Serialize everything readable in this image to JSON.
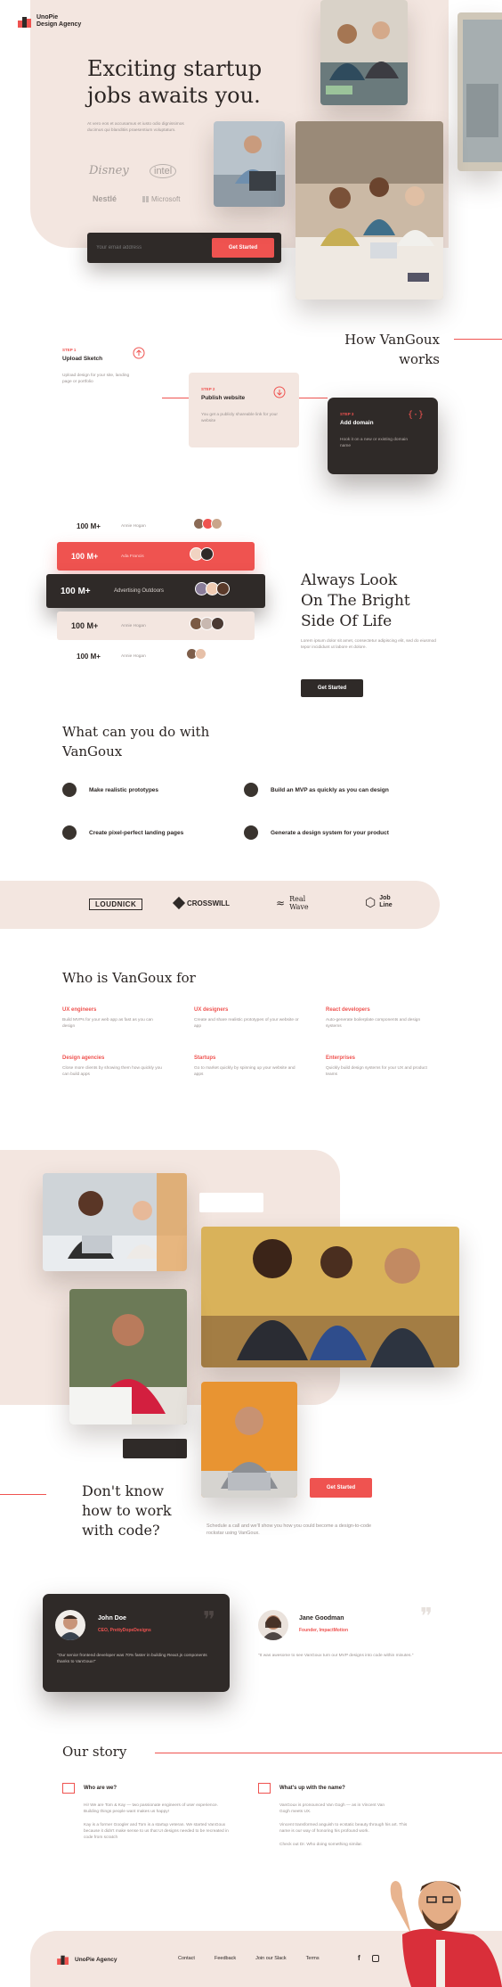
{
  "brand": {
    "name_line1": "UnoPie",
    "name_line2": "Design Agency",
    "footer_name": "UnoPie Agency"
  },
  "hero": {
    "title_line1": "Exciting startup",
    "title_line2": "jobs awaits you.",
    "description": "At vero eos et accusamus et iusto odio dignissimos ducimus qui blanditiis praesentium voluptatum.",
    "client_logos": [
      "Disney",
      "intel",
      "Nestlé",
      "Microsoft"
    ],
    "email_placeholder": "Your email address",
    "cta_label": "Get Started"
  },
  "how": {
    "title_line1": "How VanGoux",
    "title_line2": "works",
    "steps": [
      {
        "step": "STEP 1",
        "title": "Upload Sketch",
        "text": "Upload design for your site, landing page or portfolio"
      },
      {
        "step": "STEP 2",
        "title": "Publish website",
        "text": "You get a publicly shareable link for your website"
      },
      {
        "step": "STEP 3",
        "title": "Add domain",
        "text": "Hook it on a new or existing domain name"
      }
    ]
  },
  "stats": {
    "rows": [
      {
        "value": "100 M+",
        "name": "Annie Hogan"
      },
      {
        "value": "100 M+",
        "name": "Ada Francis"
      },
      {
        "value": "100 M+",
        "name": "Advertising Outdoors"
      },
      {
        "value": "100 M+",
        "name": "Annie Hogan"
      },
      {
        "value": "100 M+",
        "name": "Annie Hogan"
      }
    ]
  },
  "bright": {
    "title_line1": "Always Look",
    "title_line2": "On The Bright",
    "title_line3": "Side Of Life",
    "text": "Lorem ipsum dolor sit amet, consectetur adipiscing elit, sed do eiusmod tepor incididunt ut labore et dolore.",
    "button": "Get Started"
  },
  "what": {
    "title_line1": "What can you do with",
    "title_line2": "VanGoux",
    "features": [
      "Make realistic prototypes",
      "Build an MVP as quickly as you can design",
      "Create pixel-perfect landing pages",
      "Generate a design system for your product"
    ]
  },
  "partners": [
    "LOUDNICK",
    "CROSSWILL",
    "Real Wave",
    "Job Line"
  ],
  "who": {
    "title": "Who is VanGoux for",
    "items": [
      {
        "title": "UX engineers",
        "text": "Build MVPs for your web app as fast as you can design"
      },
      {
        "title": "UX designers",
        "text": "Create and share realistic prototypes of your website or app"
      },
      {
        "title": "React developers",
        "text": "Auto-generate boilerplate components and design systems"
      },
      {
        "title": "Design agencies",
        "text": "Close more clients by showing them how quickly you can build apps"
      },
      {
        "title": "Startups",
        "text": "Go to market quickly by spinning up your website and apps"
      },
      {
        "title": "Enterprises",
        "text": "Quickly build design systems for your UX and product teams"
      }
    ]
  },
  "code": {
    "title_line1": "Don't know",
    "title_line2": "how to work",
    "title_line3": "with code?",
    "button": "Get Started",
    "text": "Schedule a call and we'll show you how you could become a design-to-code rockstar using VanGoux."
  },
  "testimonials": [
    {
      "name": "John Doe",
      "role": "CEO, PrettyDopeDesigns",
      "quote": "\"Our senior frontend developer was 70% faster in building React.js components thanks to VanGoux!\""
    },
    {
      "name": "Jane Goodman",
      "role": "Founder, ImpactMotion",
      "quote": "\"It was awesome to see VanGoux turn our MVP designs into code within minutes.\""
    }
  ],
  "story": {
    "title": "Our story",
    "who_title": "Who are we?",
    "who_p1": "Hi! We are Tom & Kay — two passionate engineers of user experience. Building things people want makes us happy!",
    "who_p2": "Kay is a former Googler and Tom is a startup veteran. We started VanGoux because it didn't make sense to us that UI designs needed to be recreated in code from scratch",
    "name_title": "What's up with the name?",
    "name_p1": "VanGoux is pronounced Van Gogh — as in Vincent Van Gogh meets UX.",
    "name_p2": "Vincent transformed anguish to ecstatic beauty through his art. This name is our way of honoring his profound work.",
    "name_p3": "Check out Dr. Who doing something similar."
  },
  "footer": {
    "links": [
      "Contact",
      "Feedback",
      "Join our Slack",
      "Terms"
    ]
  },
  "colors": {
    "accent": "#ef5350",
    "dark": "#2f2a28",
    "beige": "#f3e6e0"
  }
}
